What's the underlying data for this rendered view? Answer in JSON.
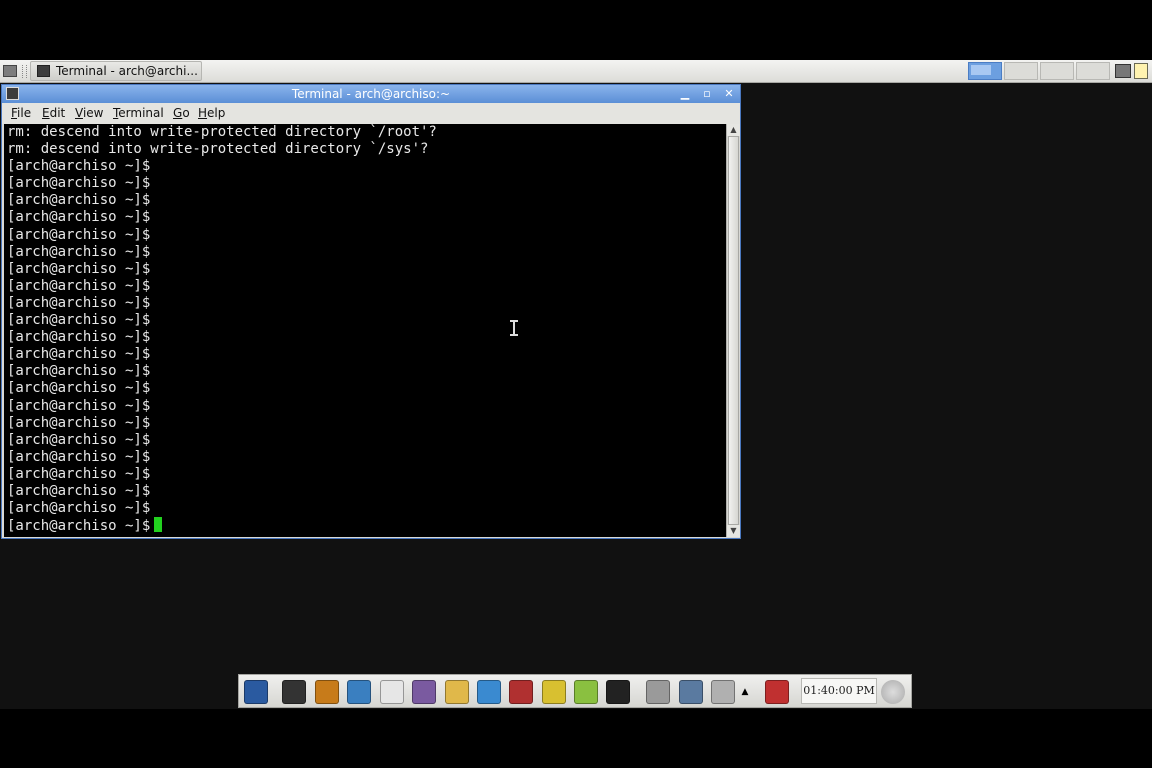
{
  "taskbar": {
    "task_label": "Terminal - arch@archi...",
    "icons": [
      "menu-icon",
      "terminal-icon",
      "workspace-pager",
      "network-icon",
      "clipboard-icon"
    ]
  },
  "window": {
    "title": "Terminal - arch@archiso:~",
    "menu": [
      "File",
      "Edit",
      "View",
      "Terminal",
      "Go",
      "Help"
    ],
    "menu_underline": [
      "F",
      "E",
      "V",
      "T",
      "G",
      "H"
    ]
  },
  "terminal": {
    "lines": [
      "rm: descend into write-protected directory `/root'?",
      "rm: descend into write-protected directory `/sys'?",
      "[arch@archiso ~]$",
      "[arch@archiso ~]$",
      "[arch@archiso ~]$",
      "[arch@archiso ~]$",
      "[arch@archiso ~]$",
      "[arch@archiso ~]$",
      "[arch@archiso ~]$",
      "[arch@archiso ~]$",
      "[arch@archiso ~]$",
      "[arch@archiso ~]$",
      "[arch@archiso ~]$",
      "[arch@archiso ~]$",
      "[arch@archiso ~]$",
      "[arch@archiso ~]$",
      "[arch@archiso ~]$",
      "[arch@archiso ~]$",
      "[arch@archiso ~]$",
      "[arch@archiso ~]$",
      "[arch@archiso ~]$",
      "[arch@archiso ~]$",
      "[arch@archiso ~]$",
      "[arch@archiso ~]$"
    ],
    "cursor_color": "#22d11f"
  },
  "bottom_panel": {
    "clock": "01:40:00 PM",
    "launchers": [
      "xfce-mouse-icon",
      "terminal-icon",
      "file-manager-icon",
      "web-browser-icon",
      "mail-icon",
      "chat-icon",
      "text-editor-icon",
      "office-tools-icon",
      "media-player-icon",
      "graphics-icon",
      "music-icon",
      "video-icon",
      "printer-icon",
      "network-icon",
      "scanner-icon",
      "menu-arrow-icon",
      "logout-icon"
    ]
  },
  "colors": {
    "titlebar": "#5b8fd6",
    "terminal_bg": "#000000",
    "terminal_fg": "#e8e8e8"
  }
}
